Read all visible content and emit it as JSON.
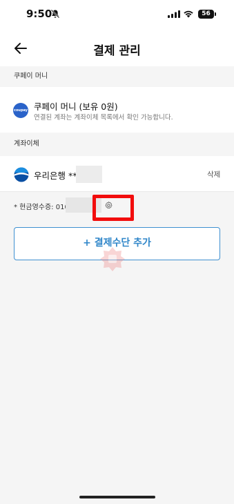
{
  "status_bar": {
    "time": "9:50",
    "battery": "56"
  },
  "header": {
    "title": "결제 관리"
  },
  "sections": {
    "coupay_money_label": "쿠페이 머니",
    "bank_transfer_label": "계좌이체"
  },
  "coupay_money": {
    "logo_text": "coupay",
    "title": "쿠페이 머니 (보유 0원)",
    "subtitle": "연결된 계좌는 계좌이체 목록에서 확인 가능합니다."
  },
  "bank_account": {
    "name": "우리은행 ****",
    "delete_label": "삭제"
  },
  "cash_receipt": {
    "text": "* 현금영수증: 010"
  },
  "add_payment_button": {
    "label": "+ 결제수단 추가"
  },
  "colors": {
    "accent": "#2f86c9",
    "highlight": "#f20d0d",
    "coupay_blue": "#2a63c9"
  }
}
